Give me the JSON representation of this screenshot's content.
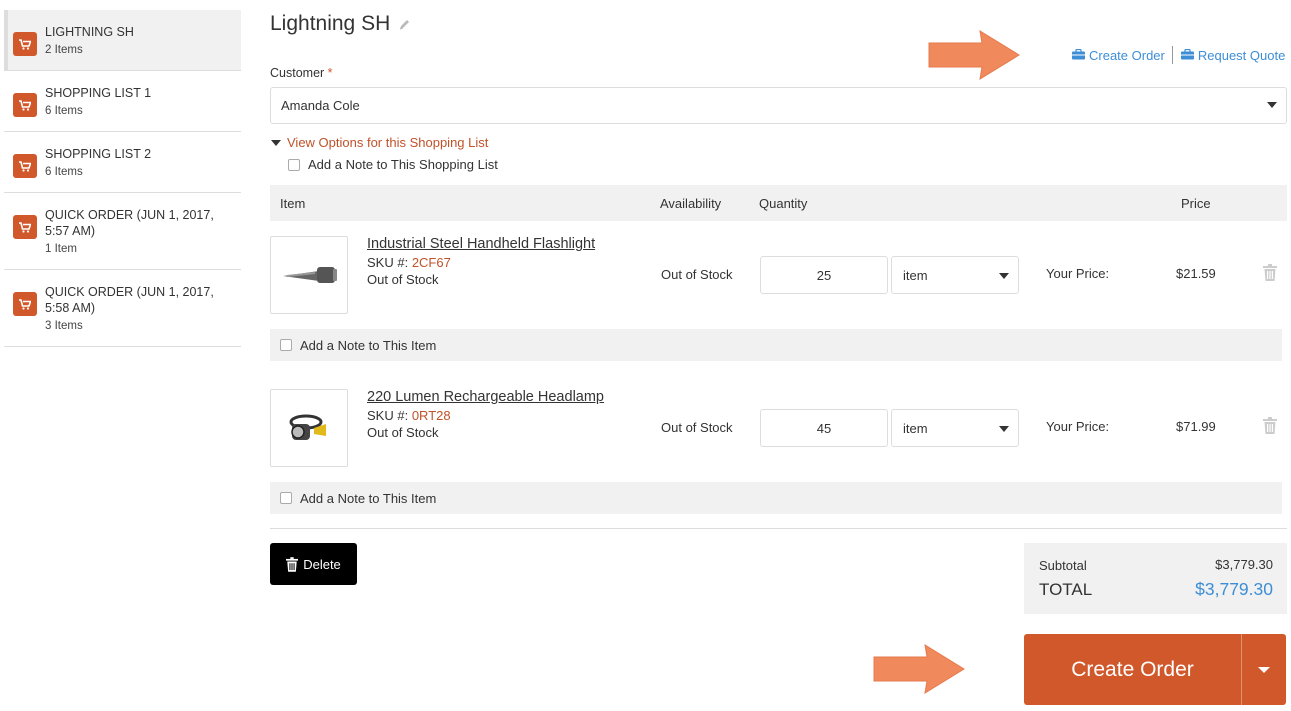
{
  "sidebar": {
    "items": [
      {
        "title": "LIGHTNING SH",
        "count": "2 Items"
      },
      {
        "title": "SHOPPING LIST 1",
        "count": "6 Items"
      },
      {
        "title": "SHOPPING LIST 2",
        "count": "6 Items"
      },
      {
        "title": "QUICK ORDER (JUN 1, 2017,",
        "title2": "5:57 AM)",
        "count": "1 Item"
      },
      {
        "title": "QUICK ORDER (JUN 1, 2017,",
        "title2": "5:58 AM)",
        "count": "3 Items"
      }
    ]
  },
  "header": {
    "title": "Lightning SH",
    "create_order": "Create Order",
    "request_quote": "Request Quote"
  },
  "customer": {
    "label": "Customer",
    "required_mark": "*",
    "value": "Amanda Cole"
  },
  "options": {
    "view_options": "View Options for this Shopping List",
    "list_note": "Add a Note to This Shopping List"
  },
  "table": {
    "headers": {
      "item": "Item",
      "availability": "Availability",
      "quantity": "Quantity",
      "price": "Price"
    },
    "rows": [
      {
        "name": "Industrial Steel Handheld Flashlight",
        "sku_label": "SKU #:",
        "sku": "2CF67",
        "stock": "Out of Stock",
        "availability": "Out of Stock",
        "quantity": "25",
        "unit": "item",
        "your_price_label": "Your Price:",
        "price": "$21.59",
        "note": "Add a Note to This Item"
      },
      {
        "name": "220 Lumen Rechargeable Headlamp",
        "sku_label": "SKU #:",
        "sku": "0RT28",
        "stock": "Out of Stock",
        "availability": "Out of Stock",
        "quantity": "45",
        "unit": "item",
        "your_price_label": "Your Price:",
        "price": "$71.99",
        "note": "Add a Note to This Item"
      }
    ]
  },
  "footer": {
    "delete": "Delete",
    "subtotal_label": "Subtotal",
    "subtotal": "$3,779.30",
    "total_label": "TOTAL",
    "total": "$3,779.30",
    "create_order": "Create Order"
  },
  "colors": {
    "accent": "#d0582a",
    "link": "#3d8ed6",
    "arrow": "#f08a5d"
  }
}
